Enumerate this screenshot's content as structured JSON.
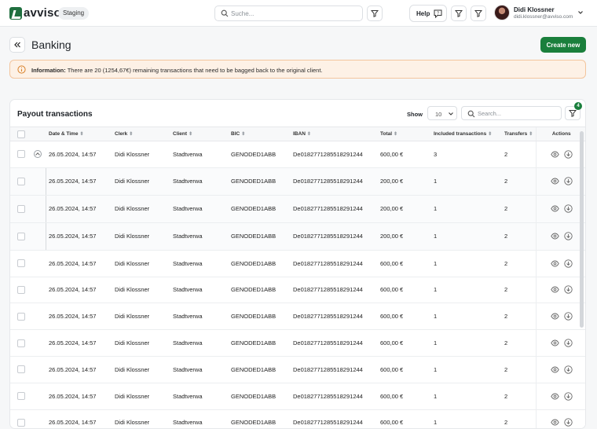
{
  "header": {
    "brand": "avviso",
    "environment": "Staging",
    "search_placeholder": "Suche...",
    "help_label": "Help",
    "user_name": "Didi Klossner",
    "user_email": "didi.klossner@avviso.com"
  },
  "page": {
    "title": "Banking",
    "create_label": "Create new"
  },
  "info": {
    "label": "Information:",
    "message": "There are 20 (1254,67€) remaining transactions that need to be bagged back to the original client."
  },
  "table_card": {
    "title": "Payout transactions",
    "show_label": "Show",
    "page_size": "10",
    "search_placeholder": "Search...",
    "filter_count": "4",
    "columns": [
      "Date & Time",
      "Clerk",
      "Client",
      "BIC",
      "IBAN",
      "Total",
      "Included transactions",
      "Transfers",
      "Actions"
    ],
    "rows": [
      {
        "date": "26.05.2024, 14:57",
        "clerk": "Didi Klossner",
        "client": "Stadtverwa",
        "bic": "GENODED1ABB",
        "iban": "De0182771285518291244",
        "total": "600,00 €",
        "included": "3",
        "transfers": "2",
        "type": "parent"
      },
      {
        "date": "26.05.2024, 14:57",
        "clerk": "Didi Klossner",
        "client": "Stadtverwa",
        "bic": "GENODED1ABB",
        "iban": "De0182771285518291244",
        "total": "200,00 €",
        "included": "1",
        "transfers": "2",
        "type": "child"
      },
      {
        "date": "26.05.2024, 14:57",
        "clerk": "Didi Klossner",
        "client": "Stadtverwa",
        "bic": "GENODED1ABB",
        "iban": "De0182771285518291244",
        "total": "200,00 €",
        "included": "1",
        "transfers": "2",
        "type": "child"
      },
      {
        "date": "26.05.2024, 14:57",
        "clerk": "Didi Klossner",
        "client": "Stadtverwa",
        "bic": "GENODED1ABB",
        "iban": "De0182771285518291244",
        "total": "200,00 €",
        "included": "1",
        "transfers": "2",
        "type": "child"
      },
      {
        "date": "26.05.2024, 14:57",
        "clerk": "Didi Klossner",
        "client": "Stadtverwa",
        "bic": "GENODED1ABB",
        "iban": "De0182771285518291244",
        "total": "600,00 €",
        "included": "1",
        "transfers": "2",
        "type": "plain"
      },
      {
        "date": "26.05.2024, 14:57",
        "clerk": "Didi Klossner",
        "client": "Stadtverwa",
        "bic": "GENODED1ABB",
        "iban": "De0182771285518291244",
        "total": "600,00 €",
        "included": "1",
        "transfers": "2",
        "type": "plain"
      },
      {
        "date": "26.05.2024, 14:57",
        "clerk": "Didi Klossner",
        "client": "Stadtverwa",
        "bic": "GENODED1ABB",
        "iban": "De0182771285518291244",
        "total": "600,00 €",
        "included": "1",
        "transfers": "2",
        "type": "plain"
      },
      {
        "date": "26.05.2024, 14:57",
        "clerk": "Didi Klossner",
        "client": "Stadtverwa",
        "bic": "GENODED1ABB",
        "iban": "De0182771285518291244",
        "total": "600,00 €",
        "included": "1",
        "transfers": "2",
        "type": "plain"
      },
      {
        "date": "26.05.2024, 14:57",
        "clerk": "Didi Klossner",
        "client": "Stadtverwa",
        "bic": "GENODED1ABB",
        "iban": "De0182771285518291244",
        "total": "600,00 €",
        "included": "1",
        "transfers": "2",
        "type": "plain"
      },
      {
        "date": "26.05.2024, 14:57",
        "clerk": "Didi Klossner",
        "client": "Stadtverwa",
        "bic": "GENODED1ABB",
        "iban": "De0182771285518291244",
        "total": "600,00 €",
        "included": "1",
        "transfers": "2",
        "type": "plain"
      },
      {
        "date": "26.05.2024, 14:57",
        "clerk": "Didi Klossner",
        "client": "Stadtverwa",
        "bic": "GENODED1ABB",
        "iban": "De0182771285518291244",
        "total": "600,00 €",
        "included": "1",
        "transfers": "2",
        "type": "plain"
      }
    ]
  },
  "icons": {
    "brand_color": "#1a7f3c",
    "info_color": "#d9822b",
    "warning_bg": "#fdf1e6"
  }
}
